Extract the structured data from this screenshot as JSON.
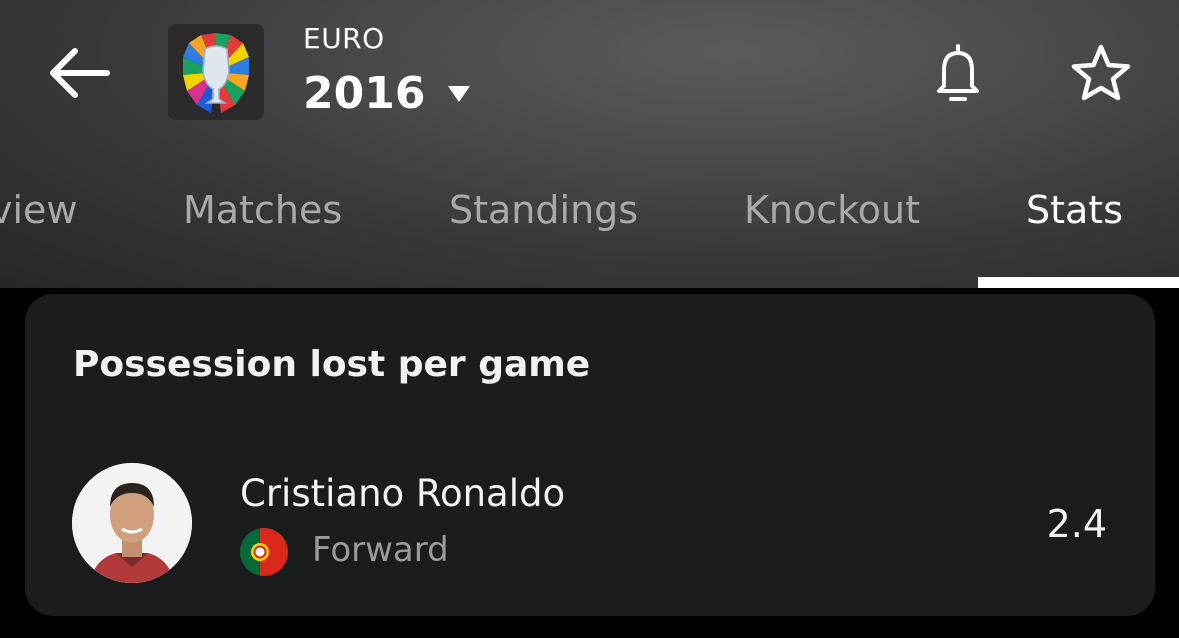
{
  "header": {
    "competition": "EURO",
    "season": "2016",
    "icons": {
      "back": "back-arrow-icon",
      "dropdown": "caret-down-icon",
      "notifications": "bell-icon",
      "favorite": "star-icon"
    }
  },
  "tabs": [
    {
      "label": "view",
      "active": false
    },
    {
      "label": "Matches",
      "active": false
    },
    {
      "label": "Standings",
      "active": false
    },
    {
      "label": "Knockout",
      "active": false
    },
    {
      "label": "Stats",
      "active": true
    }
  ],
  "stat_card": {
    "title": "Possession lost per game",
    "player": {
      "name": "Cristiano Ronaldo",
      "position": "Forward",
      "value": "2.4"
    }
  },
  "colors": {
    "card_bg": "#1b1c1e",
    "inactive_tab": "#a9a9a9",
    "secondary_text": "#9b9b9b",
    "portugal_green": "#046a38",
    "portugal_red": "#da291c"
  }
}
